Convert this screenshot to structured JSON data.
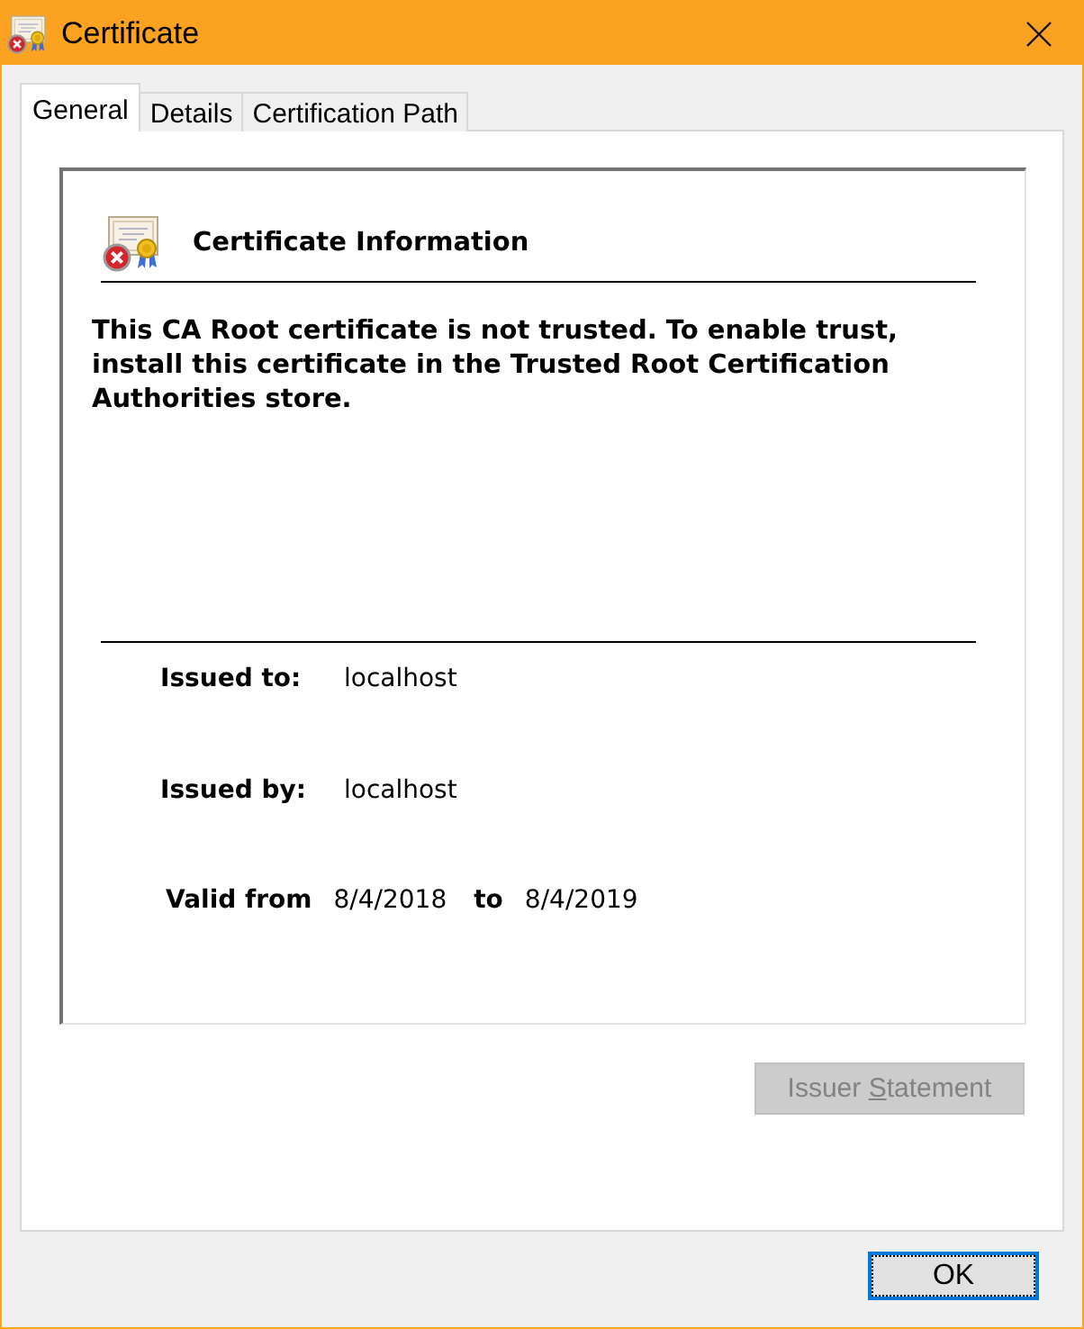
{
  "window": {
    "title": "Certificate"
  },
  "tabs": [
    {
      "label": "General",
      "selected": true
    },
    {
      "label": "Details",
      "selected": false
    },
    {
      "label": "Certification Path",
      "selected": false
    }
  ],
  "general": {
    "trusted": false,
    "heading": "Certificate Information",
    "message": "This CA Root certificate is not trusted. To enable trust, install this certificate in the Trusted Root Certification Authorities store.",
    "fields": [
      {
        "label": "Issued to:",
        "value": "localhost"
      },
      {
        "label": "Issued by:",
        "value": "localhost"
      }
    ],
    "validity": {
      "label": "Valid from",
      "from": "8/4/2018",
      "separator": "to",
      "to": "8/4/2019"
    },
    "issuer_statement": {
      "label_before": "Issuer ",
      "access_key": "S",
      "label_after": "tatement",
      "disabled": true
    }
  },
  "ok_button": {
    "label": "OK",
    "focused": true
  }
}
